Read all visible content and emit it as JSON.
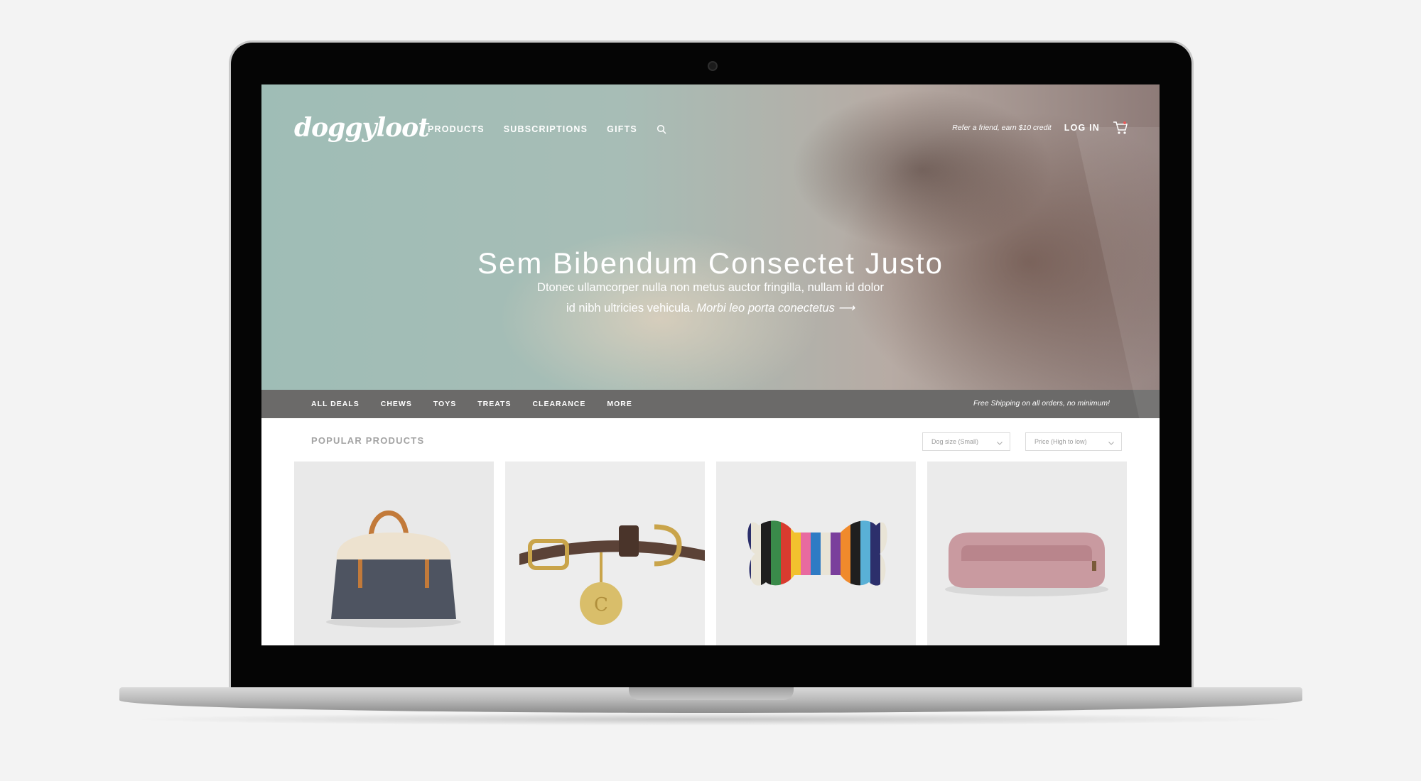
{
  "brand": {
    "logo_text": "doggyloot"
  },
  "nav": {
    "items": [
      "PRODUCTS",
      "SUBSCRIPTIONS",
      "GIFTS"
    ],
    "search_icon": "search-icon"
  },
  "account": {
    "refer_text": "Refer a friend, earn $10 credit",
    "login_label": "LOG IN",
    "cart_icon": "cart-icon"
  },
  "hero": {
    "title": "Sem Bibendum Consectet Justo",
    "body_line1": "Dtonec ullamcorper nulla non metus auctor fringilla, nullam id dolor",
    "body_line2": "id nibh ultricies vehicula.",
    "link_text": "Morbi leo porta conectetus ⟶"
  },
  "categories": {
    "items": [
      "ALL DEALS",
      "CHEWS",
      "TOYS",
      "TREATS",
      "CLEARANCE",
      "MORE"
    ],
    "shipping_note": "Free Shipping on all orders, no minimum!"
  },
  "products": {
    "section_title": "POPULAR PRODUCTS",
    "filters": {
      "size": "Dog size (Small)",
      "sort": "Price (High to low)"
    },
    "items": [
      {
        "kind": "dog carrier bag"
      },
      {
        "kind": "leather collar with tag"
      },
      {
        "kind": "striped bone toy"
      },
      {
        "kind": "pink dog bed"
      }
    ]
  },
  "colors": {
    "hero_teal": "#9fbdb6",
    "category_bar": "#6b6a69",
    "muted_heading": "#a3a3a3"
  }
}
